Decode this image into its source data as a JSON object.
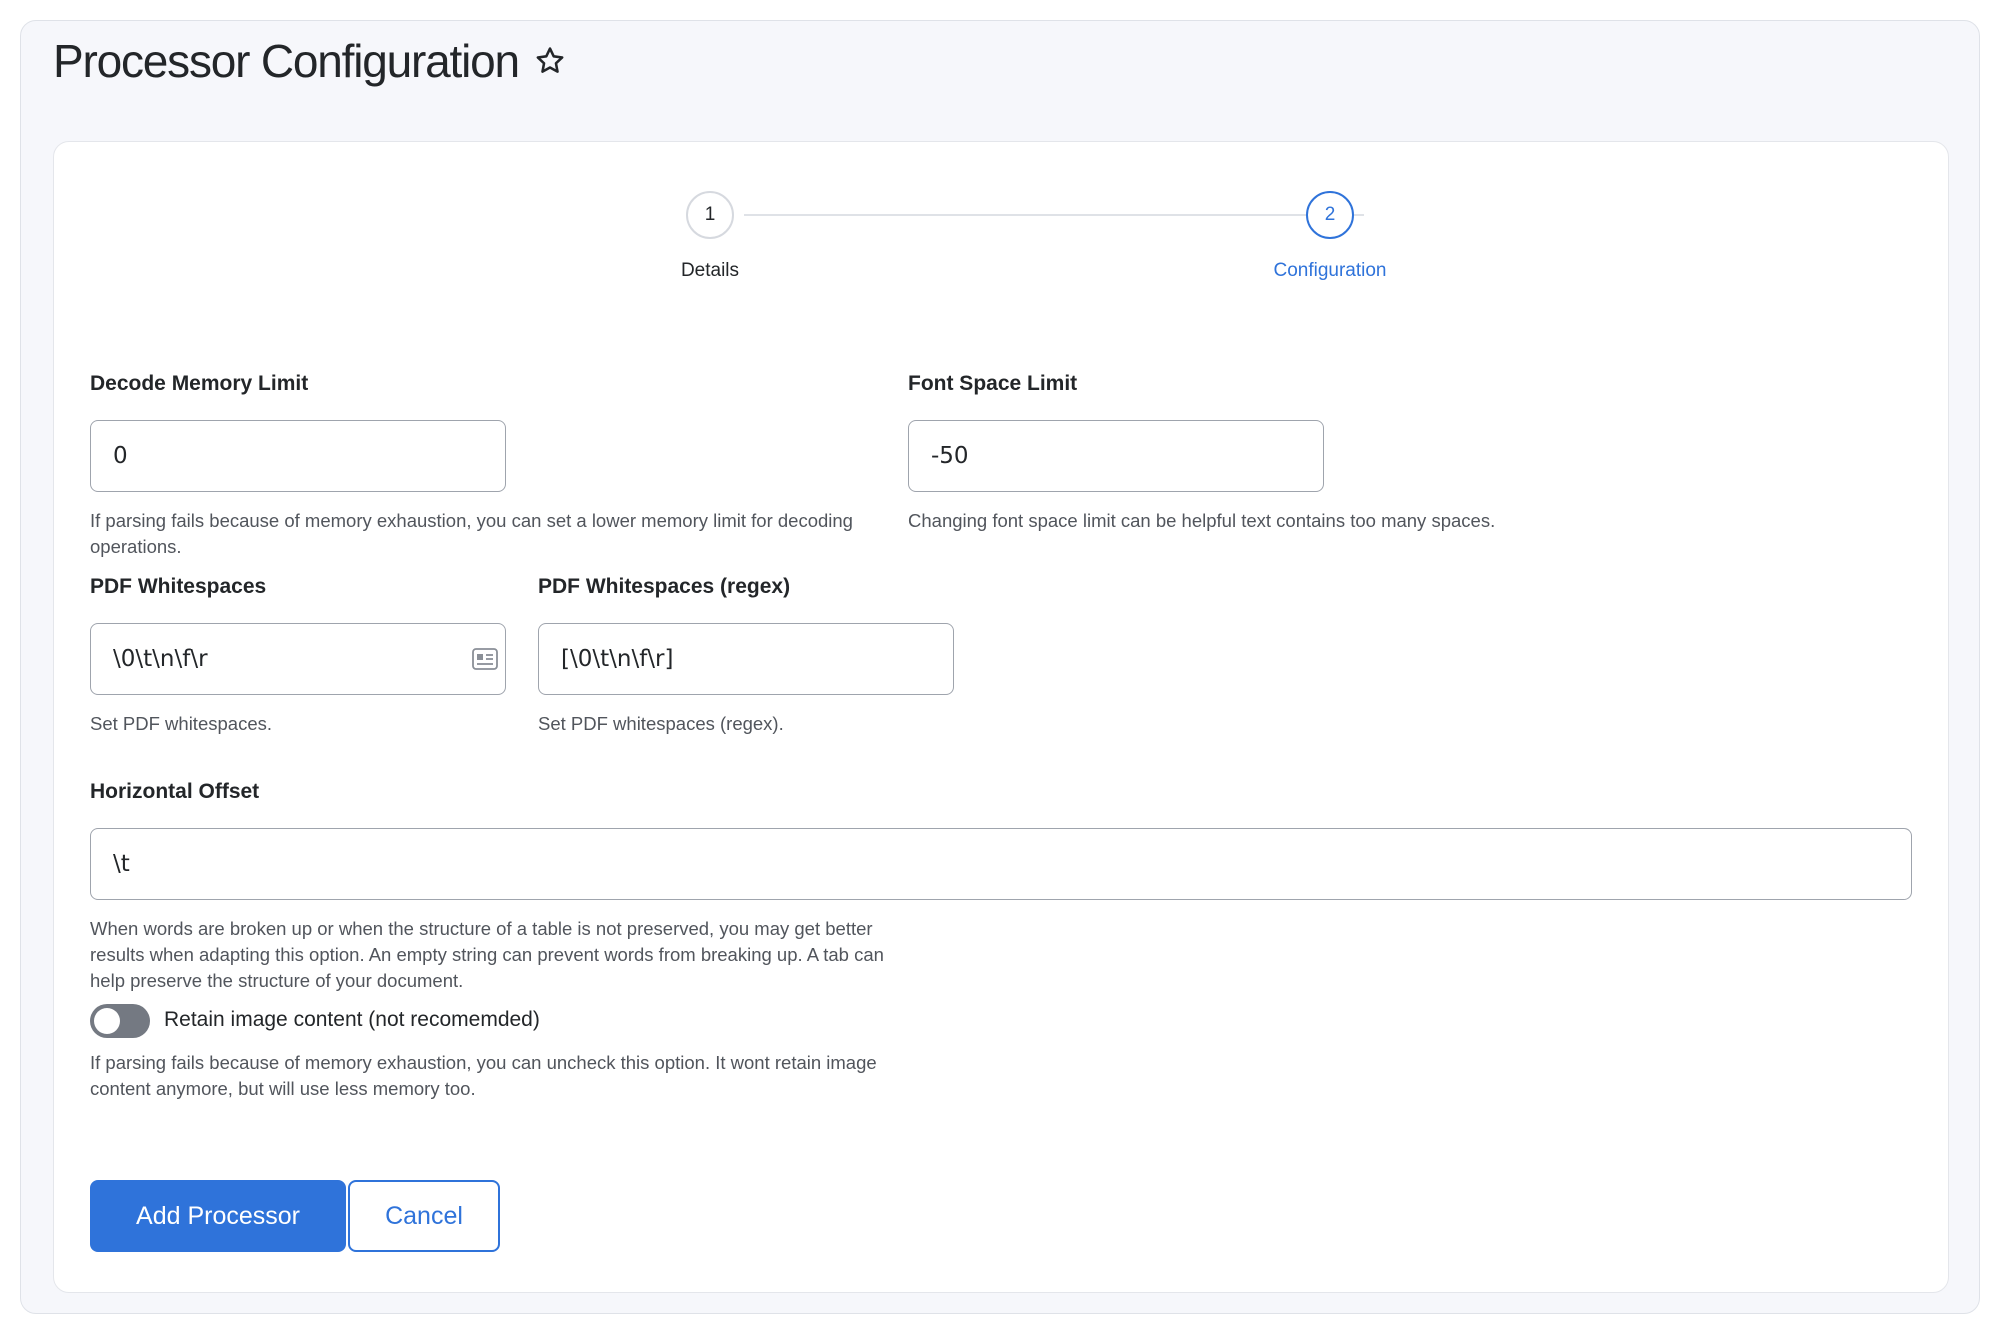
{
  "page": {
    "title": "Processor Configuration",
    "favorite_icon": "star-outline-icon"
  },
  "stepper": {
    "steps": [
      {
        "number": "1",
        "label": "Details",
        "active": false
      },
      {
        "number": "2",
        "label": "Configuration",
        "active": true
      }
    ]
  },
  "form": {
    "decode_memory_limit": {
      "label": "Decode Memory Limit",
      "value": "0",
      "help": "If parsing fails because of memory exhaustion, you can set a lower memory limit for decoding operations."
    },
    "font_space_limit": {
      "label": "Font Space Limit",
      "value": "-50",
      "help": "Changing font space limit can be helpful text contains too many spaces."
    },
    "pdf_whitespaces": {
      "label": "PDF Whitespaces",
      "value": "\\0\\t\\n\\f\\r",
      "help": "Set PDF whitespaces.",
      "icon": "list-card-icon"
    },
    "pdf_whitespaces_regex": {
      "label": "PDF Whitespaces (regex)",
      "value": "[\\0\\t\\n\\f\\r]",
      "help": "Set PDF whitespaces (regex)."
    },
    "horizontal_offset": {
      "label": "Horizontal Offset",
      "value": "\\t",
      "help": "When words are broken up or when the structure of a table is not preserved, you may get better results when adapting this option. An empty string can prevent words from breaking up. A tab can help preserve the structure of your document."
    },
    "retain_image_content": {
      "label": "Retain image content (not recomemded)",
      "checked": false,
      "help": "If parsing fails because of memory exhaustion, you can uncheck this option. It wont retain image content anymore, but will use less memory too."
    }
  },
  "actions": {
    "primary_label": "Add Processor",
    "secondary_label": "Cancel"
  },
  "colors": {
    "accent": "#2f73da",
    "toggle_off": "#747982",
    "panel_bg": "#f6f7fb"
  }
}
